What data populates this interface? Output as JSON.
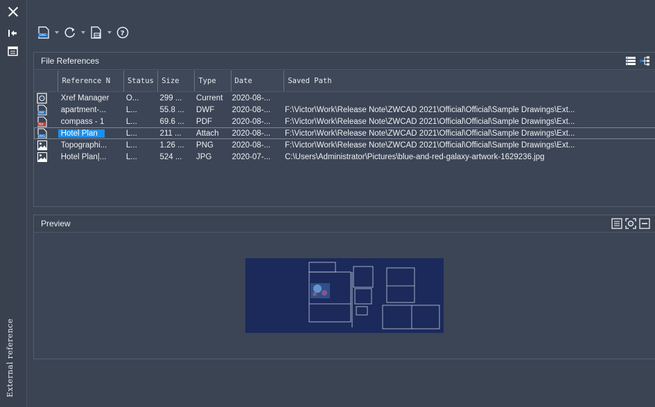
{
  "window": {
    "vertical_title": "External reference"
  },
  "toolbar": {
    "icons": [
      "attach-dwg-icon",
      "refresh-icon",
      "change-path-icon",
      "help-icon"
    ]
  },
  "file_references": {
    "title": "File References",
    "columns": [
      "Reference N",
      "Status",
      "Size",
      "Type",
      "Date",
      "Saved Path"
    ],
    "rows": [
      {
        "icon": "xref-manager-icon",
        "name": "Xref Manager",
        "status": "O...",
        "size": "299 ...",
        "type": "Current",
        "date": "2020-08-...",
        "path": ""
      },
      {
        "icon": "dwf-file-icon",
        "name": "apartment-...",
        "status": "L...",
        "size": "55.8 ...",
        "type": "DWF",
        "date": "2020-08-...",
        "path": "F:\\Victor\\Work\\Release Note\\ZWCAD 2021\\Official\\Official\\Sample Drawings\\Ext..."
      },
      {
        "icon": "pdf-file-icon",
        "name": "compass - 1",
        "status": "L...",
        "size": "69.6 ...",
        "type": "PDF",
        "date": "2020-08-...",
        "path": "F:\\Victor\\Work\\Release Note\\ZWCAD 2021\\Official\\Official\\Sample Drawings\\Ext..."
      },
      {
        "icon": "dwg-file-icon",
        "name": "Hotel Plan",
        "status": "L...",
        "size": "211 ...",
        "type": "Attach",
        "date": "2020-08-...",
        "path": "F:\\Victor\\Work\\Release Note\\ZWCAD 2021\\Official\\Official\\Sample Drawings\\Ext...",
        "selected": true
      },
      {
        "icon": "image-file-icon",
        "name": "Topographi...",
        "status": "L...",
        "size": "1.26 ...",
        "type": "PNG",
        "date": "2020-08-...",
        "path": "F:\\Victor\\Work\\Release Note\\ZWCAD 2021\\Official\\Official\\Sample Drawings\\Ext..."
      },
      {
        "icon": "image-file-icon",
        "name": "Hotel Plan|...",
        "status": "L...",
        "size": "524 ...",
        "type": "JPG",
        "date": "2020-07-...",
        "path": "C:\\Users\\Administrator\\Pictures\\blue-and-red-galaxy-artwork-1629236.jpg"
      }
    ]
  },
  "preview": {
    "title": "Preview"
  },
  "colors": {
    "background": "#3b4453",
    "selection": "#1e8fe9"
  }
}
